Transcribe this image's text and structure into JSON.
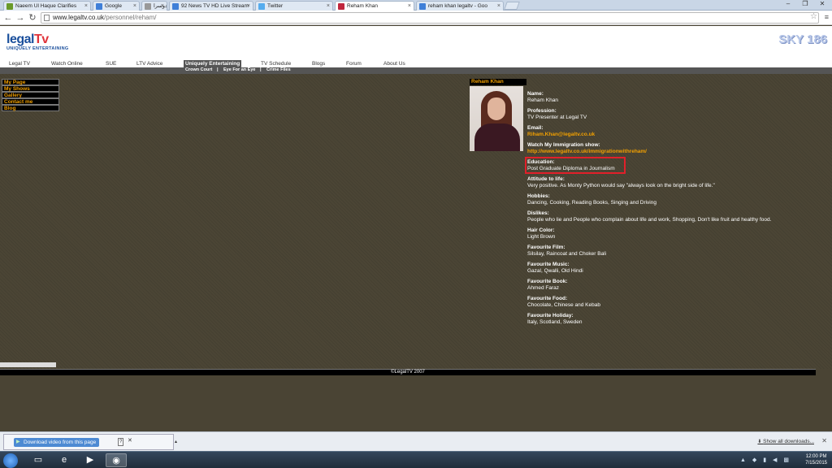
{
  "browser": {
    "tabs": [
      {
        "label": "Naeem Ul Haque Clarifies",
        "favicon_color": "#6a9a2a",
        "active": false
      },
      {
        "label": "Google",
        "favicon_color": "#3f7fd8",
        "active": false
      },
      {
        "label": "نئی آنکھوں سے - آلڈریچ دوسرا",
        "favicon_color": "#999999",
        "active": false
      },
      {
        "label": "92 News TV HD Live Stream",
        "favicon_color": "#3f7fd8",
        "active": false
      },
      {
        "label": "Twitter",
        "favicon_color": "#55acee",
        "active": false
      },
      {
        "label": "Reham Khan",
        "favicon_color": "#c0273d",
        "active": true
      },
      {
        "label": "reham khan legaltv - Goo",
        "favicon_color": "#3f7fd8",
        "active": false
      }
    ],
    "url_host": "www.legaltv.co.uk",
    "url_path": "/personnel/reham/"
  },
  "site": {
    "logo_legal": "legal",
    "logo_tv": "Tv",
    "tagline": "UNIQUELY ENTERTAINING",
    "sky": "SKY 186",
    "nav": [
      "Legal TV",
      "Watch Online",
      "SUE",
      "LTV Advice",
      "Uniquely Entertaining",
      "TV Schedule",
      "Blogs",
      "Forum",
      "About Us"
    ],
    "subnav": [
      "Crown Court",
      "|",
      "Eye For an Eye",
      "|",
      "Crime Files"
    ]
  },
  "sidemenu": [
    "My Page",
    "My Shows",
    "Gallery",
    "Contact me",
    "Blog"
  ],
  "profile": {
    "title": "Reham Khan",
    "fields": [
      {
        "label": "Name:",
        "value": "Reham Khan",
        "link": false
      },
      {
        "label": "Profession:",
        "value": "TV Presenter at Legal TV",
        "link": false
      },
      {
        "label": "Email:",
        "value": "Riham.Khan@legaltv.co.uk",
        "link": true
      },
      {
        "label": "Watch My Immigration show:",
        "value": "http://www.legaltv.co.uk/immigrationwithreham/",
        "link": true
      },
      {
        "label": "Education:",
        "value": "Post Graduate Diploma in Journalism",
        "link": false
      },
      {
        "label": "Attitude to life:",
        "value": "Very positive.  As Monty Python would say \"always look on the bright side of life.\"",
        "link": false
      },
      {
        "label": "Hobbies:",
        "value": "Dancing, Cooking, Reading Books, Singing and Driving",
        "link": false
      },
      {
        "label": "Dislikes:",
        "value": "People who lie and People who complain about life and work, Shopping, Don't like fruit and healthy food.",
        "link": false
      },
      {
        "label": "Hair Color:",
        "value": "Light Brown",
        "link": false
      },
      {
        "label": "Favourite Film:",
        "value": "Silsilay, Raincoat and Choker Bali",
        "link": false
      },
      {
        "label": "Favourite Music:",
        "value": "Gazal, Qwalli, Old Hindi",
        "link": false
      },
      {
        "label": "Favourite Book:",
        "value": "Ahmed Faraz",
        "link": false
      },
      {
        "label": "Favourite Food:",
        "value": "Chocolate, Chinese and Kebab",
        "link": false
      },
      {
        "label": "Favourite Holiday:",
        "value": "Italy, Scotland, Sweden",
        "link": false
      }
    ]
  },
  "footer": "©LegalTV 2007",
  "downloads": {
    "item_label": "Download video from this page",
    "help": "?",
    "show_all": "Show all downloads..."
  },
  "taskbar": {
    "time": "12:00 PM",
    "date": "7/15/2015"
  }
}
